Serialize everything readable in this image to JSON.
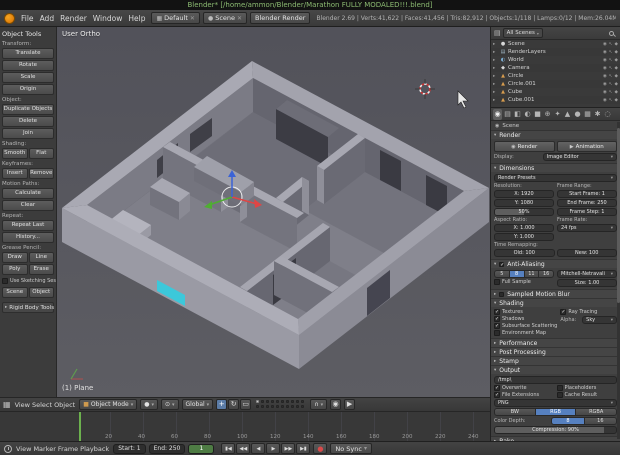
{
  "window": {
    "title": "Blender* [/home/ammon/Blender/Marathon FULLY MODALED!!!.blend]"
  },
  "colors": {
    "accent_blue": "#5680bf",
    "blender_orange": "#e87d0d",
    "frame_green": "#6cb14e",
    "axis_x": "#e04545",
    "axis_y": "#4fae32",
    "axis_z": "#3b63d6",
    "highlight_cyan": "#3cc8da",
    "title_green": "#8cbb72"
  },
  "menubar": {
    "menus": [
      "File",
      "Add",
      "Render",
      "Window",
      "Help"
    ],
    "layout_dropdown": "Default",
    "scene_dropdown": "Scene",
    "engine_dropdown": "Blender Render",
    "stats": "Blender 2.69 | Verts:41,622 | Faces:41,456 | Tris:82,912 | Objects:1/118 | Lamps:0/12 | Mem:26.04M (0.13M) | Plane"
  },
  "toolshelf": {
    "title": "Object Tools",
    "sections": [
      {
        "label": "Transform:",
        "layout": "col",
        "buttons": [
          "Translate",
          "Rotate",
          "Scale"
        ]
      },
      {
        "layout": "col",
        "buttons": [
          "Origin"
        ]
      },
      {
        "label": "Object:",
        "layout": "col",
        "buttons": [
          "Duplicate Objects",
          "Delete",
          "Join"
        ]
      },
      {
        "label": "Shading:",
        "layout": "row",
        "buttons": [
          "Smooth",
          "Flat"
        ]
      },
      {
        "label": "Keyframes:",
        "layout": "row",
        "buttons": [
          "Insert",
          "Remove"
        ]
      },
      {
        "label": "Motion Paths:",
        "layout": "col",
        "buttons": [
          "Calculate",
          "Clear"
        ]
      },
      {
        "label": "Repeat:",
        "layout": "col",
        "buttons": [
          "Repeat Last",
          "History..."
        ]
      },
      {
        "label": "Grease Pencil:",
        "layout": "row",
        "buttons": [
          "Draw",
          "Line",
          "Poly",
          "Erase"
        ]
      },
      {
        "layout": "check",
        "label": "Use Sketching Sessions",
        "on": false
      },
      {
        "layout": "row",
        "buttons": [
          "Scene",
          "Object"
        ]
      }
    ],
    "footer_panel": "Rigid Body Tools"
  },
  "viewport": {
    "view_label": "User Ortho",
    "object_label": "(1) Plane"
  },
  "view3d_header": {
    "menus": [
      "View",
      "Select",
      "Object"
    ],
    "mode": "Object Mode",
    "orientation": "Global",
    "manipulators": [
      {
        "name": "translate-manipulator-button",
        "glyph": "+",
        "active": true
      },
      {
        "name": "rotate-manipulator-button",
        "glyph": "↻",
        "active": false
      },
      {
        "name": "scale-manipulator-button",
        "glyph": "▭",
        "active": false
      }
    ]
  },
  "outliner": {
    "scope": "All Scenes",
    "items": [
      {
        "name": "Scene",
        "icon": "scene-icon"
      },
      {
        "name": "RenderLayers",
        "icon": "renderlayers-icon"
      },
      {
        "name": "World",
        "icon": "world-icon"
      },
      {
        "name": "Camera",
        "icon": "camera-icon"
      },
      {
        "name": "Circle",
        "icon": "mesh-icon"
      },
      {
        "name": "Circle.001",
        "icon": "mesh-icon"
      },
      {
        "name": "Cube",
        "icon": "mesh-icon"
      },
      {
        "name": "Cube.001",
        "icon": "mesh-icon"
      }
    ]
  },
  "properties": {
    "tabs": [
      {
        "name": "tab-render",
        "active": true
      },
      {
        "name": "tab-render-layers",
        "active": false
      },
      {
        "name": "tab-scene",
        "active": false
      },
      {
        "name": "tab-world",
        "active": false
      },
      {
        "name": "tab-object",
        "active": false
      },
      {
        "name": "tab-constraints",
        "active": false
      },
      {
        "name": "tab-modifiers",
        "active": false
      },
      {
        "name": "tab-data",
        "active": false
      },
      {
        "name": "tab-material",
        "active": false
      },
      {
        "name": "tab-texture",
        "active": false
      },
      {
        "name": "tab-particles",
        "active": false
      },
      {
        "name": "tab-physics",
        "active": false
      }
    ],
    "breadcrumb": "Scene",
    "render": {
      "title": "Render",
      "render_btn": "Render",
      "animation_btn": "Animation",
      "display_label": "Display:",
      "display_value": "Image Editor"
    },
    "dimensions": {
      "title": "Dimensions",
      "presets": "Render Presets",
      "resolution_label": "Resolution:",
      "frame_range_label": "Frame Range:",
      "res_x": "X: 1920",
      "res_y": "Y: 1080",
      "res_pct": "50%",
      "res_pct_fill": 50,
      "start": "Start Frame: 1",
      "end": "End Frame: 250",
      "step": "Frame Step: 1",
      "aspect_label": "Aspect Ratio:",
      "rate_label": "Frame Rate:",
      "asp_x": "X: 1.000",
      "asp_y": "Y: 1.000",
      "fps": "24 fps",
      "remap_label": "Time Remapping:",
      "old": "Old: 100",
      "new": "New: 100"
    },
    "anti_aliasing": {
      "title": "Anti-Aliasing",
      "samples": [
        "5",
        "8",
        "11",
        "16"
      ],
      "active_sample": "8",
      "filter": "Mitchell-Netravali",
      "full_sample": "Full Sample",
      "size": "Size: 1.00"
    },
    "motion_blur": {
      "title": "Sampled Motion Blur"
    },
    "shading": {
      "title": "Shading",
      "checks_left": [
        {
          "label": "Textures",
          "on": true
        },
        {
          "label": "Shadows",
          "on": true
        },
        {
          "label": "Subsurface Scattering",
          "on": true
        },
        {
          "label": "Environment Map",
          "on": false
        }
      ],
      "checks_right": [
        {
          "label": "Ray Tracing",
          "on": true
        }
      ],
      "alpha_label": "Alpha:",
      "alpha_value": "Sky"
    },
    "performance": {
      "title": "Performance"
    },
    "post_processing": {
      "title": "Post Processing"
    },
    "stamp": {
      "title": "Stamp"
    },
    "output": {
      "title": "Output",
      "path": "/tmp\\",
      "checks": [
        {
          "label": "Overwrite",
          "on": true
        },
        {
          "label": "Placeholders",
          "on": false
        },
        {
          "label": "File Extensions",
          "on": true
        },
        {
          "label": "Cache Result",
          "on": false
        }
      ],
      "format": "PNG",
      "modes": [
        "BW",
        "RGB",
        "RGBA"
      ],
      "active_mode": "RGB",
      "depth_label": "Color Depth:",
      "depths": [
        "8",
        "16"
      ],
      "active_depth": "8",
      "compression": "Compression: 90%",
      "compression_fill": 90
    },
    "bake": {
      "title": "Bake"
    }
  },
  "timeline": {
    "menus": [
      "View",
      "Marker",
      "Frame",
      "Playback"
    ],
    "start": "Start: 1",
    "end": "End: 250",
    "current": "1",
    "sync": "No Sync",
    "record_glyph": "●",
    "transport": [
      {
        "name": "jump-to-start-button",
        "glyph": "▮◀"
      },
      {
        "name": "prev-keyframe-button",
        "glyph": "◀◀"
      },
      {
        "name": "play-reverse-button",
        "glyph": "◀"
      },
      {
        "name": "play-button",
        "glyph": "▶"
      },
      {
        "name": "next-keyframe-button",
        "glyph": "▶▶"
      },
      {
        "name": "jump-to-end-button",
        "glyph": "▶▮"
      }
    ],
    "ruler_labels": [
      "20",
      "40",
      "60",
      "80",
      "100",
      "120",
      "140",
      "160",
      "180",
      "200",
      "220",
      "240"
    ]
  }
}
